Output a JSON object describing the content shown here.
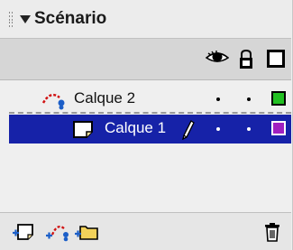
{
  "panel": {
    "title": "Scénario"
  },
  "header": {
    "icons": [
      "eye-icon",
      "lock-icon",
      "outline-icon"
    ]
  },
  "layers": [
    {
      "name": "Calque 2",
      "icon": "motion-guide-layer-icon",
      "visible": "•",
      "locked": "•",
      "outline_color": "#22c022",
      "selected": false
    },
    {
      "name": "Calque 1",
      "icon": "layer-icon",
      "visible": "•",
      "locked": "•",
      "outline_color": "#a020c0",
      "selected": true,
      "editing_icon": "pencil-icon"
    }
  ],
  "footer": {
    "icons": [
      "insert-layer-icon",
      "add-motion-guide-icon",
      "insert-folder-icon",
      "trash-icon"
    ]
  },
  "colors": {
    "selection": "#1622a8",
    "panel_bg": "#efefef"
  }
}
